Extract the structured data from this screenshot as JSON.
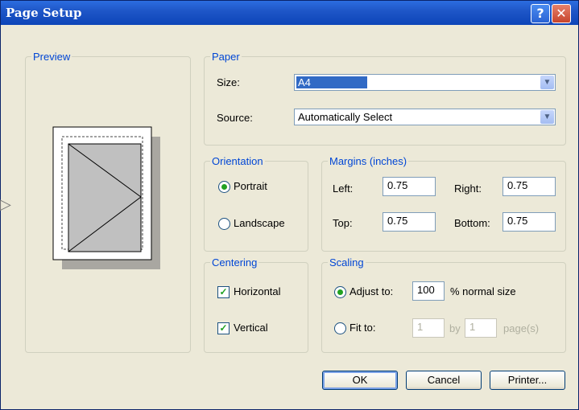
{
  "window": {
    "title": "Page Setup",
    "help_glyph": "?",
    "close_glyph": "✕"
  },
  "preview": {
    "legend": "Preview"
  },
  "paper": {
    "legend": "Paper",
    "size_label": "Size:",
    "size_value": "A4",
    "source_label": "Source:",
    "source_value": "Automatically Select"
  },
  "orientation": {
    "legend": "Orientation",
    "portrait": "Portrait",
    "landscape": "Landscape",
    "selected": "portrait"
  },
  "margins": {
    "legend": "Margins (inches)",
    "left_label": "Left:",
    "left_value": "0.75",
    "right_label": "Right:",
    "right_value": "0.75",
    "top_label": "Top:",
    "top_value": "0.75",
    "bottom_label": "Bottom:",
    "bottom_value": "0.75"
  },
  "centering": {
    "legend": "Centering",
    "horizontal": "Horizontal",
    "horizontal_checked": true,
    "vertical": "Vertical",
    "vertical_checked": true
  },
  "scaling": {
    "legend": "Scaling",
    "adjust_label": "Adjust to:",
    "adjust_value": "100",
    "adjust_suffix": "% normal size",
    "fit_label": "Fit to:",
    "fit_wide": "1",
    "fit_by": "by",
    "fit_tall": "1",
    "fit_suffix": "page(s)"
  },
  "buttons": {
    "ok": "OK",
    "cancel": "Cancel",
    "printer": "Printer..."
  },
  "colors": {
    "title_bar": "#1f57c8",
    "dialog_bg": "#ece9d8",
    "legend_text": "#0046d5"
  }
}
